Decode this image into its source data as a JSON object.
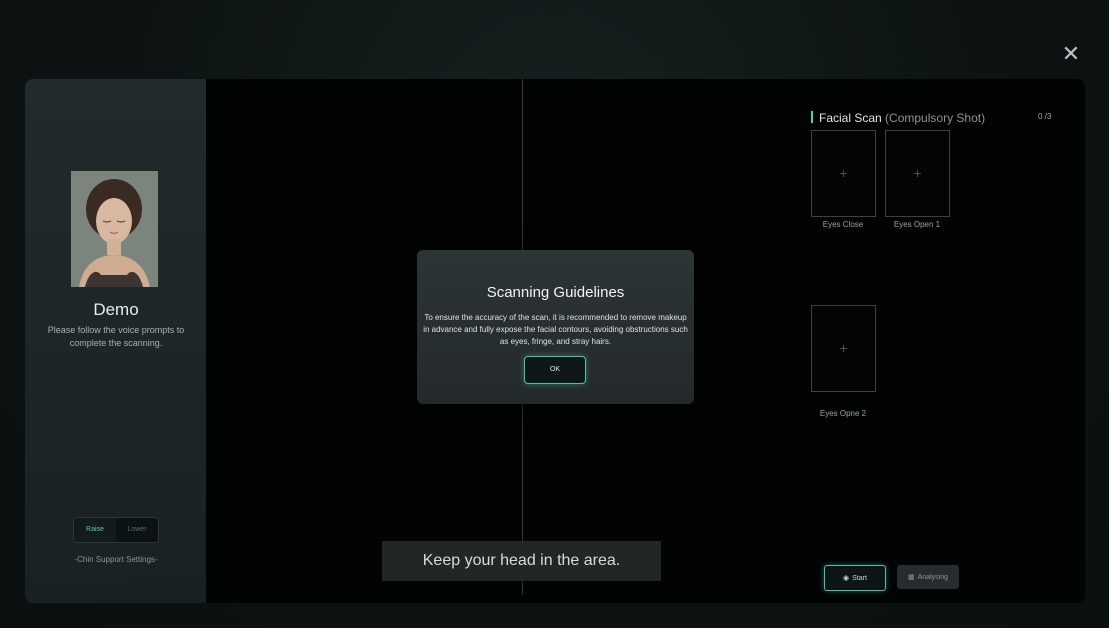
{
  "window": {
    "close_icon": "close-icon"
  },
  "sidebar": {
    "demo_name": "Demo",
    "demo_description": "Please follow the voice prompts to complete the scanning.",
    "chin_toggle": {
      "options": [
        "Raise",
        "Lower"
      ],
      "selected": "Raise"
    },
    "chin_label": "-Chin Support Settings-"
  },
  "main": {
    "hint": "Keep your head in the area."
  },
  "scan_panel": {
    "title": "Facial Scan",
    "subtitle": "(Compulsory Shot)",
    "count": "0 /3",
    "slots": [
      {
        "label": "Eyes Close"
      },
      {
        "label": "Eyes Open 1"
      },
      {
        "label": "Eyes Opne 2"
      }
    ],
    "start_label": "Start",
    "analysing_label": "Analysing"
  },
  "modal": {
    "title": "Scanning Guidelines",
    "body": "To ensure the accuracy of the scan, it is recommended to remove makeup in advance and fully expose the facial contours, avoiding obstructions such as eyes, fringe, and stray hairs.",
    "ok_label": "OK"
  },
  "colors": {
    "accent": "#4ac1ae",
    "background": "#0c1112",
    "panel": "#020303"
  }
}
